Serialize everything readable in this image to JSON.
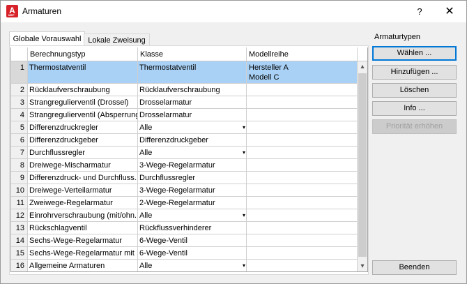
{
  "window": {
    "title": "Armaturen",
    "help_label": "?",
    "close_label": "✕",
    "app_icon_letter": "A",
    "app_icon_sub": "MEP"
  },
  "tabs": [
    {
      "label": "Globale Vorauswahl",
      "active": true
    },
    {
      "label": "Lokale Zweisung",
      "active": false
    }
  ],
  "grid": {
    "columns": [
      "",
      "Berechnungstyp",
      "Klasse",
      "Modellreihe"
    ],
    "rows": [
      {
        "num": "1",
        "typ": "Thermostatventil",
        "klasse": "Thermostatventil",
        "modell_line1": "Hersteller A",
        "modell_line2": "Modell C",
        "dropdown": false,
        "selected": true
      },
      {
        "num": "2",
        "typ": "Rücklaufverschraubung",
        "klasse": "Rücklaufverschraubung",
        "dropdown": false
      },
      {
        "num": "3",
        "typ": "Strangregulierventil (Drossel)",
        "klasse": "Drosselarmatur",
        "dropdown": false
      },
      {
        "num": "4",
        "typ": "Strangregulierventil (Absperrung)",
        "klasse": "Drosselarmatur",
        "dropdown": false
      },
      {
        "num": "5",
        "typ": "Differenzdruckregler",
        "klasse": "Alle",
        "dropdown": true
      },
      {
        "num": "6",
        "typ": "Differenzdruckgeber",
        "klasse": "Differenzdruckgeber",
        "dropdown": false
      },
      {
        "num": "7",
        "typ": "Durchflussregler",
        "klasse": "Alle",
        "dropdown": true
      },
      {
        "num": "8",
        "typ": "Dreiwege-Mischarmatur",
        "klasse": "3-Wege-Regelarmatur",
        "dropdown": false
      },
      {
        "num": "9",
        "typ": "Differenzdruck- und Durchfluss...",
        "klasse": "Durchflussregler",
        "dropdown": false
      },
      {
        "num": "10",
        "typ": "Dreiwege-Verteilarmatur",
        "klasse": "3-Wege-Regelarmatur",
        "dropdown": false
      },
      {
        "num": "11",
        "typ": "Zweiwege-Regelarmatur",
        "klasse": "2-Wege-Regelarmatur",
        "dropdown": false
      },
      {
        "num": "12",
        "typ": "Einrohrverschraubung (mit/ohn...",
        "klasse": "Alle",
        "dropdown": true
      },
      {
        "num": "13",
        "typ": "Rückschlagventil",
        "klasse": "Rückflussverhinderer",
        "dropdown": false
      },
      {
        "num": "14",
        "typ": "Sechs-Wege-Regelarmatur",
        "klasse": "6-Wege-Ventil",
        "dropdown": false
      },
      {
        "num": "15",
        "typ": "Sechs-Wege-Regelarmatur mit ...",
        "klasse": "6-Wege-Ventil",
        "dropdown": false
      },
      {
        "num": "16",
        "typ": "Allgemeine Armaturen",
        "klasse": "Alle",
        "dropdown": true
      }
    ],
    "dropdown_glyph": "▾",
    "scroll_up_glyph": "▴",
    "scroll_down_glyph": "▾"
  },
  "side": {
    "group_label": "Armaturtypen",
    "buttons": [
      {
        "label": "Wählen ...",
        "state": "default"
      },
      {
        "label": "Hinzufügen ...",
        "state": "normal"
      },
      {
        "label": "Löschen",
        "state": "normal"
      },
      {
        "label": "Info ...",
        "state": "normal"
      },
      {
        "label": "Priorität erhöhen",
        "state": "disabled"
      }
    ],
    "end_label": "Beenden"
  }
}
